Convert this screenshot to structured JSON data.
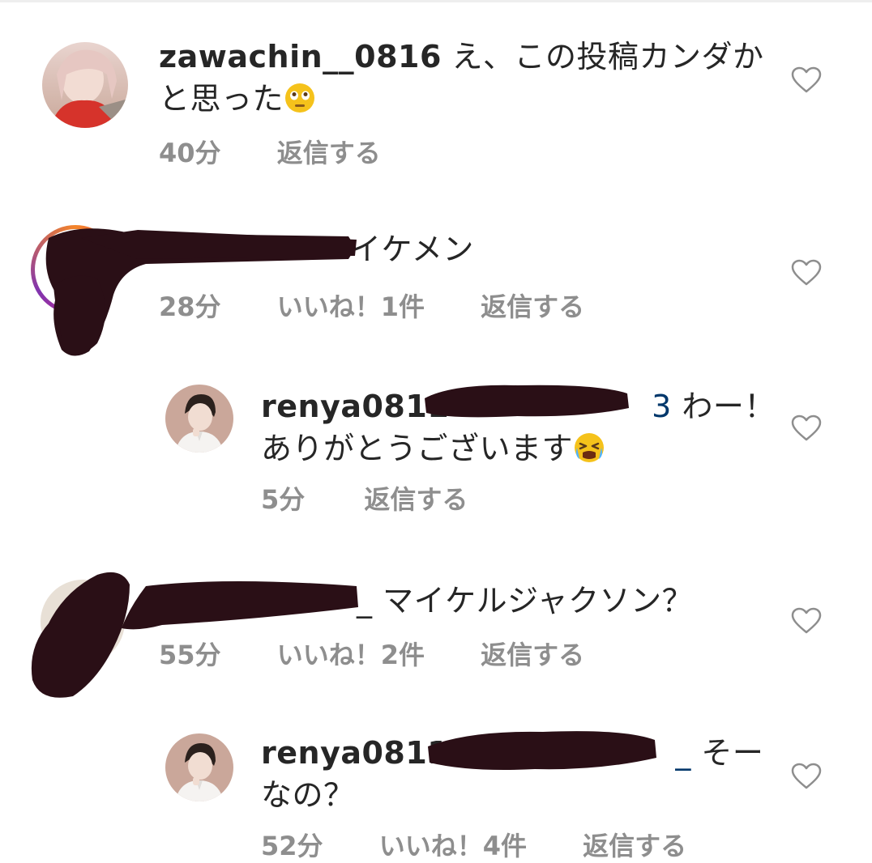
{
  "comments": [
    {
      "username": "zawachin__0816",
      "text_line1": " え、この投稿カンダか",
      "text_line2": "と思った",
      "time": "40分",
      "reply": "返信する"
    },
    {
      "text": "イケメン",
      "time": "28分",
      "likes": "いいね！1件",
      "reply": "返信する"
    },
    {
      "username": "renya0811",
      "mention_tail": "3",
      "text_line1": " わー！",
      "text_line2": "ありがとうございます",
      "time": "5分",
      "reply": "返信する"
    },
    {
      "text_prefix": "_",
      "text": " マイケルジャクソン？",
      "time": "55分",
      "likes": "いいね！2件",
      "reply": "返信する"
    },
    {
      "username": "renya0811",
      "mention_tail": "_",
      "text_line1": " そー",
      "text_line2": "なの？",
      "time": "52分",
      "likes": "いいね！4件",
      "reply": "返信する"
    }
  ],
  "icons": {
    "like": "heart-outline-icon",
    "emoji1": "flushed-face-emoji",
    "emoji2": "crying-face-emoji"
  },
  "colors": {
    "text": "#262626",
    "meta": "#8e8e8e",
    "mention": "#00376b",
    "redaction": "#2a0f16"
  }
}
